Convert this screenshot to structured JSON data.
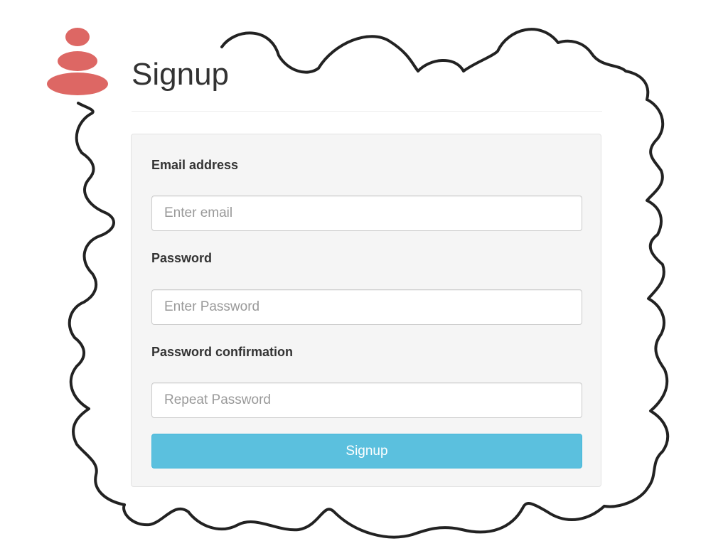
{
  "header": {
    "title": "Signup",
    "logo_icon": "stacked-stones-icon"
  },
  "form": {
    "email": {
      "label": "Email address",
      "value": "",
      "placeholder": "Enter email"
    },
    "password": {
      "label": "Password",
      "value": "",
      "placeholder": "Enter Password"
    },
    "password_confirmation": {
      "label": "Password confirmation",
      "value": "",
      "placeholder": "Repeat Password"
    },
    "submit_label": "Signup"
  },
  "colors": {
    "logo": "#d9534f",
    "button": "#5bc0de",
    "panel": "#f5f5f5"
  }
}
